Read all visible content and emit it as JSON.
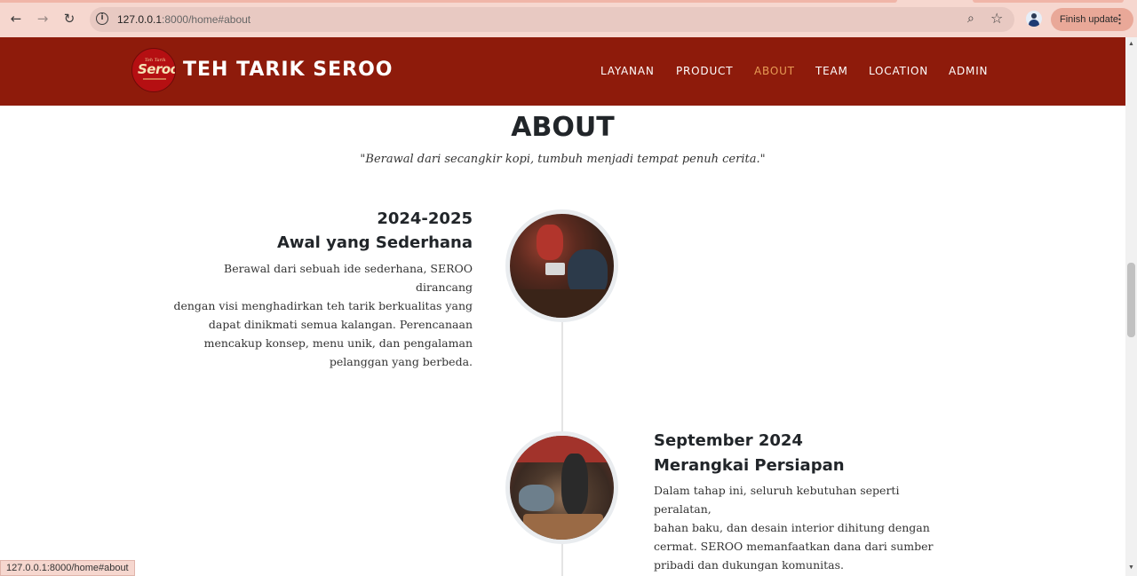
{
  "browser": {
    "url_host": "127.0.0.1",
    "url_path": ":8000/home#about",
    "update_label": "Finish update",
    "status_url": "127.0.0.1:8000/home#about"
  },
  "header": {
    "logo_text": "Seroo.",
    "logo_small": "Teh Tarik",
    "site_title": "TEH TARIK SEROO",
    "nav": [
      {
        "label": "LAYANAN"
      },
      {
        "label": "PRODUCT"
      },
      {
        "label": "ABOUT",
        "active": true
      },
      {
        "label": "TEAM"
      },
      {
        "label": "LOCATION"
      },
      {
        "label": "ADMIN"
      }
    ]
  },
  "about": {
    "title": "ABOUT",
    "subtitle": "\"Berawal dari secangkir kopi, tumbuh menjadi tempat penuh cerita.\"",
    "timeline": [
      {
        "year": "2024-2025",
        "heading": "Awal yang Sederhana",
        "lines": [
          "Berawal dari sebuah ide sederhana, SEROO dirancang",
          "dengan visi menghadirkan teh tarik berkualitas yang",
          "dapat dinikmati semua kalangan. Perencanaan",
          "mencakup konsep, menu unik, dan pengalaman",
          "pelanggan yang berbeda."
        ]
      },
      {
        "year": "September 2024",
        "heading": "Merangkai Persiapan",
        "lines": [
          "Dalam tahap ini, seluruh kebutuhan seperti peralatan,",
          "bahan baku, dan desain interior dihitung dengan",
          "cermat. SEROO memanfaatkan dana dari sumber",
          "pribadi dan dukungan komunitas."
        ]
      }
    ]
  },
  "colors": {
    "header_bg": "#8e1b0b",
    "nav_active": "#e79b55",
    "text_dark": "#212529"
  }
}
